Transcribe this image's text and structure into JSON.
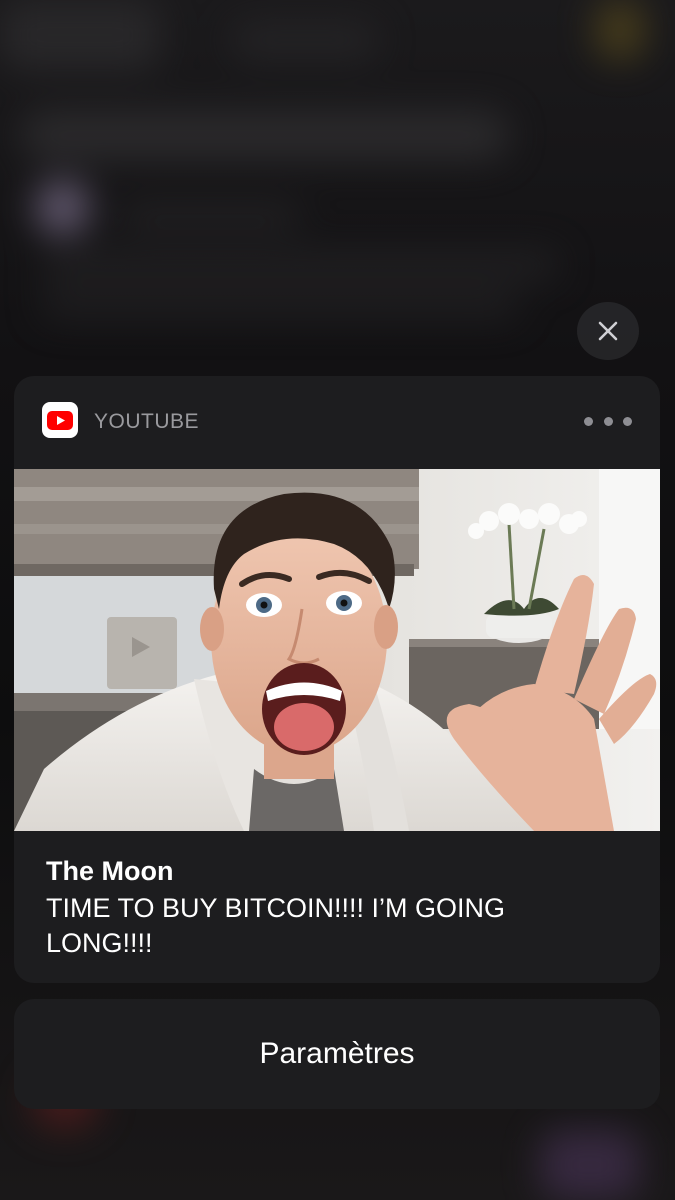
{
  "notification": {
    "app_name": "YOUTUBE",
    "title": "The Moon",
    "message": "TIME TO BUY BITCOIN!!!! I’M GOING LONG!!!!",
    "icons": {
      "app": "youtube-icon",
      "more": "more-options-icon",
      "close": "close-icon"
    },
    "brand_color": "#FF0000"
  },
  "actions": {
    "settings_label": "Paramètres"
  }
}
